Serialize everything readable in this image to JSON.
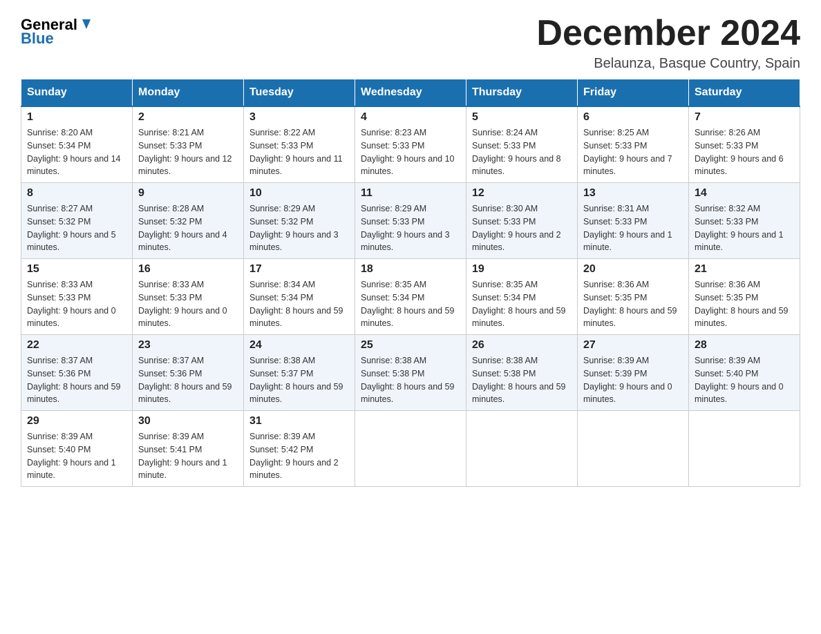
{
  "header": {
    "logo_general": "General",
    "logo_blue": "Blue",
    "month_title": "December 2024",
    "subtitle": "Belaunza, Basque Country, Spain"
  },
  "days_of_week": [
    "Sunday",
    "Monday",
    "Tuesday",
    "Wednesday",
    "Thursday",
    "Friday",
    "Saturday"
  ],
  "weeks": [
    [
      {
        "day": "1",
        "sunrise": "8:20 AM",
        "sunset": "5:34 PM",
        "daylight": "9 hours and 14 minutes."
      },
      {
        "day": "2",
        "sunrise": "8:21 AM",
        "sunset": "5:33 PM",
        "daylight": "9 hours and 12 minutes."
      },
      {
        "day": "3",
        "sunrise": "8:22 AM",
        "sunset": "5:33 PM",
        "daylight": "9 hours and 11 minutes."
      },
      {
        "day": "4",
        "sunrise": "8:23 AM",
        "sunset": "5:33 PM",
        "daylight": "9 hours and 10 minutes."
      },
      {
        "day": "5",
        "sunrise": "8:24 AM",
        "sunset": "5:33 PM",
        "daylight": "9 hours and 8 minutes."
      },
      {
        "day": "6",
        "sunrise": "8:25 AM",
        "sunset": "5:33 PM",
        "daylight": "9 hours and 7 minutes."
      },
      {
        "day": "7",
        "sunrise": "8:26 AM",
        "sunset": "5:33 PM",
        "daylight": "9 hours and 6 minutes."
      }
    ],
    [
      {
        "day": "8",
        "sunrise": "8:27 AM",
        "sunset": "5:32 PM",
        "daylight": "9 hours and 5 minutes."
      },
      {
        "day": "9",
        "sunrise": "8:28 AM",
        "sunset": "5:32 PM",
        "daylight": "9 hours and 4 minutes."
      },
      {
        "day": "10",
        "sunrise": "8:29 AM",
        "sunset": "5:32 PM",
        "daylight": "9 hours and 3 minutes."
      },
      {
        "day": "11",
        "sunrise": "8:29 AM",
        "sunset": "5:33 PM",
        "daylight": "9 hours and 3 minutes."
      },
      {
        "day": "12",
        "sunrise": "8:30 AM",
        "sunset": "5:33 PM",
        "daylight": "9 hours and 2 minutes."
      },
      {
        "day": "13",
        "sunrise": "8:31 AM",
        "sunset": "5:33 PM",
        "daylight": "9 hours and 1 minute."
      },
      {
        "day": "14",
        "sunrise": "8:32 AM",
        "sunset": "5:33 PM",
        "daylight": "9 hours and 1 minute."
      }
    ],
    [
      {
        "day": "15",
        "sunrise": "8:33 AM",
        "sunset": "5:33 PM",
        "daylight": "9 hours and 0 minutes."
      },
      {
        "day": "16",
        "sunrise": "8:33 AM",
        "sunset": "5:33 PM",
        "daylight": "9 hours and 0 minutes."
      },
      {
        "day": "17",
        "sunrise": "8:34 AM",
        "sunset": "5:34 PM",
        "daylight": "8 hours and 59 minutes."
      },
      {
        "day": "18",
        "sunrise": "8:35 AM",
        "sunset": "5:34 PM",
        "daylight": "8 hours and 59 minutes."
      },
      {
        "day": "19",
        "sunrise": "8:35 AM",
        "sunset": "5:34 PM",
        "daylight": "8 hours and 59 minutes."
      },
      {
        "day": "20",
        "sunrise": "8:36 AM",
        "sunset": "5:35 PM",
        "daylight": "8 hours and 59 minutes."
      },
      {
        "day": "21",
        "sunrise": "8:36 AM",
        "sunset": "5:35 PM",
        "daylight": "8 hours and 59 minutes."
      }
    ],
    [
      {
        "day": "22",
        "sunrise": "8:37 AM",
        "sunset": "5:36 PM",
        "daylight": "8 hours and 59 minutes."
      },
      {
        "day": "23",
        "sunrise": "8:37 AM",
        "sunset": "5:36 PM",
        "daylight": "8 hours and 59 minutes."
      },
      {
        "day": "24",
        "sunrise": "8:38 AM",
        "sunset": "5:37 PM",
        "daylight": "8 hours and 59 minutes."
      },
      {
        "day": "25",
        "sunrise": "8:38 AM",
        "sunset": "5:38 PM",
        "daylight": "8 hours and 59 minutes."
      },
      {
        "day": "26",
        "sunrise": "8:38 AM",
        "sunset": "5:38 PM",
        "daylight": "8 hours and 59 minutes."
      },
      {
        "day": "27",
        "sunrise": "8:39 AM",
        "sunset": "5:39 PM",
        "daylight": "9 hours and 0 minutes."
      },
      {
        "day": "28",
        "sunrise": "8:39 AM",
        "sunset": "5:40 PM",
        "daylight": "9 hours and 0 minutes."
      }
    ],
    [
      {
        "day": "29",
        "sunrise": "8:39 AM",
        "sunset": "5:40 PM",
        "daylight": "9 hours and 1 minute."
      },
      {
        "day": "30",
        "sunrise": "8:39 AM",
        "sunset": "5:41 PM",
        "daylight": "9 hours and 1 minute."
      },
      {
        "day": "31",
        "sunrise": "8:39 AM",
        "sunset": "5:42 PM",
        "daylight": "9 hours and 2 minutes."
      },
      null,
      null,
      null,
      null
    ]
  ]
}
